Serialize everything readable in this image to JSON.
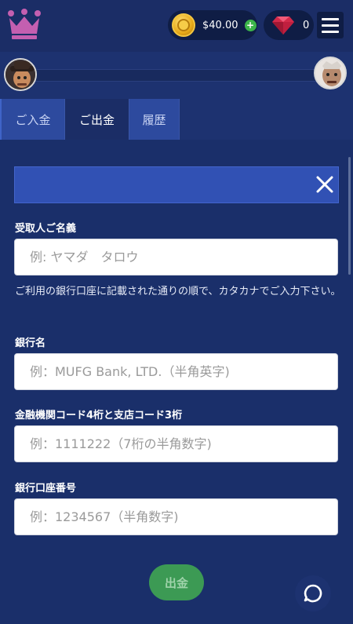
{
  "header": {
    "balance": "$40.00",
    "gem_count": "0",
    "plus_symbol": "+",
    "icons": {
      "logo": "crown-icon",
      "coin": "coin-icon",
      "gem": "gem-icon",
      "menu": "hamburger-menu-icon"
    },
    "colors": {
      "logo": "#c45fb0",
      "add": "#3cb54a",
      "gem": "#d22a4a"
    }
  },
  "tabs": [
    {
      "label": "ご入金"
    },
    {
      "label": "ご出金",
      "active": true
    },
    {
      "label": "履歴"
    }
  ],
  "form": {
    "recipient": {
      "label": "受取人ご名義",
      "placeholder": "例: ヤマダ　タロウ",
      "note": "ご利用の銀行口座に記載された通りの順で、カタカナでご入力下さい。"
    },
    "bank_name": {
      "label": "銀行名",
      "placeholder": "例：MUFG Bank, LTD.（半角英字)"
    },
    "codes": {
      "label": "金融機関コード4桁と支店コード3桁",
      "placeholder": "例：1111222（7桁の半角数字)"
    },
    "account_number": {
      "label": "銀行口座番号",
      "placeholder": "例：1234567（半角数字)"
    },
    "submit_label": "出金"
  },
  "colors": {
    "background": "#1a2f6a",
    "banner": "#3151b4",
    "submit": "#3c9a54"
  }
}
